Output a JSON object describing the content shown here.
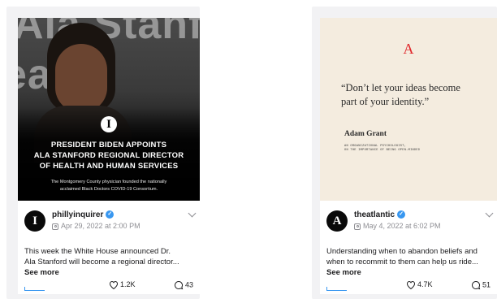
{
  "posts": [
    {
      "account": "phillyinquirer",
      "date": "Apr 29, 2022 at 2:00 PM",
      "avatar_glyph": "I",
      "media": {
        "background_words": [
          "Ala Stanf",
          "ealt"
        ],
        "logo_glyph": "I",
        "headline_lines": [
          "PRESIDENT BIDEN APPOINTS",
          "ALA STANFORD REGIONAL DIRECTOR",
          "OF HEALTH AND HUMAN SERVICES"
        ],
        "subhead_lines": [
          "The Montgomery County physician founded the nationally",
          "acclaimed Black Doctors COVID-19 Consortium."
        ]
      },
      "caption_lines": [
        "This week the White House announced Dr.",
        "Ala Stanford will become a regional director..."
      ],
      "see_more": "See more",
      "likes": "1.2K",
      "comments": "43",
      "icons": [
        "verified-icon",
        "instagram-icon",
        "chevron-down-icon",
        "share-icon",
        "heart-icon",
        "comment-icon"
      ]
    },
    {
      "account": "theatlantic",
      "date": "May 4, 2022 at 6:02 PM",
      "avatar_glyph": "A",
      "media": {
        "brand_glyph": "A",
        "quote_lines": [
          "“Don’t let your ideas become",
          "part of your identity.”"
        ],
        "author": "Adam Grant",
        "author_sub_lines": [
          "AN ORGANIZATIONAL PSYCHOLOGIST,",
          "ON THE IMPORTANCE OF BEING OPEN-MINDED"
        ]
      },
      "caption_lines": [
        "Understanding when to abandon beliefs and",
        "when to recommit to them can help us ride..."
      ],
      "see_more": "See more",
      "likes": "4.7K",
      "comments": "51",
      "icons": [
        "verified-icon",
        "instagram-icon",
        "chevron-down-icon",
        "share-icon",
        "heart-icon",
        "comment-icon"
      ]
    }
  ],
  "colors": {
    "verified": "#3897f0",
    "atlantic_red": "#e0262a",
    "quote_bg": "#f4ecdf",
    "card_bg": "#f2f2f4"
  }
}
